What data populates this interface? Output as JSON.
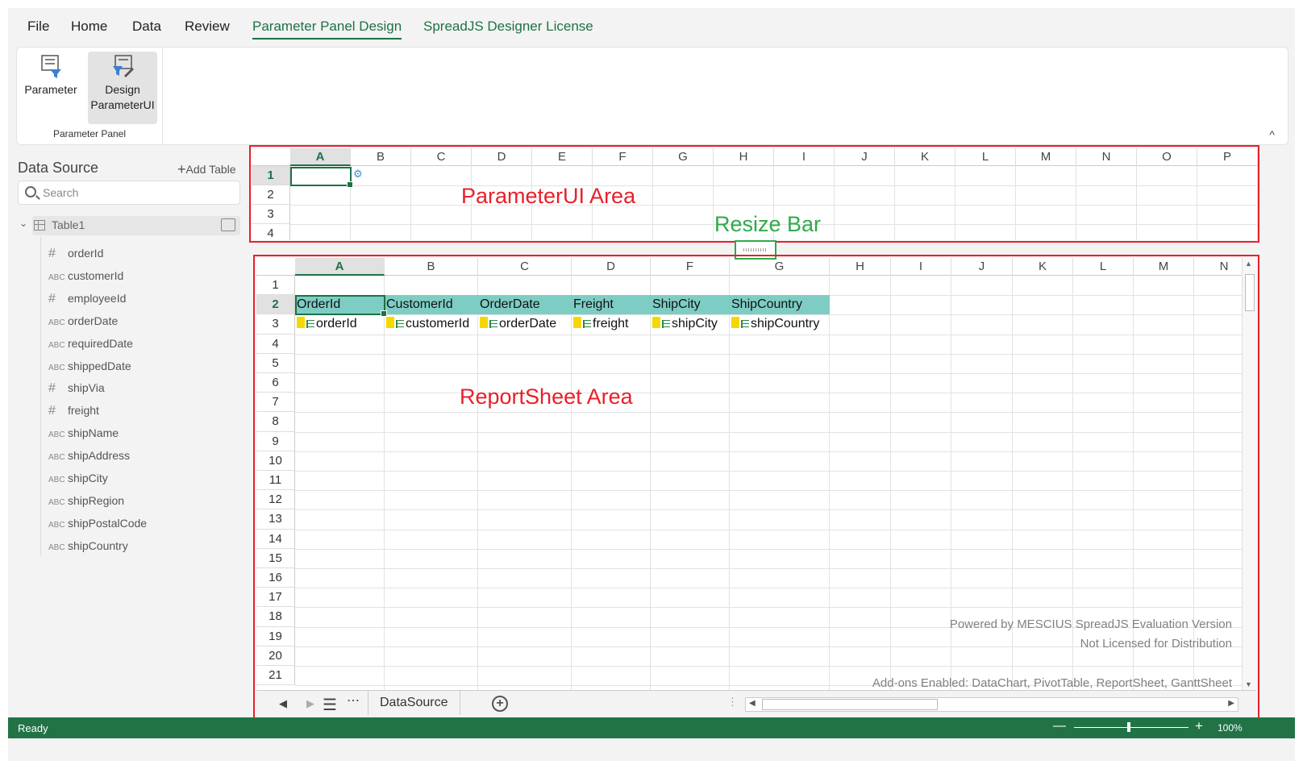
{
  "menu": {
    "items": [
      "File",
      "Home",
      "Data",
      "Review",
      "Parameter Panel Design",
      "SpreadJS Designer License"
    ],
    "active": "Parameter Panel Design"
  },
  "ribbon": {
    "parameter_label": "Parameter",
    "design_label_line1": "Design",
    "design_label_line2": "ParameterUI",
    "group_label": "Parameter Panel",
    "collapse_icon": "^"
  },
  "datasource": {
    "title": "Data Source",
    "add_table": "Add Table",
    "search_placeholder": "Search",
    "table_name": "Table1",
    "fields": [
      {
        "type": "#",
        "name": "orderId"
      },
      {
        "type": "ABC",
        "name": "customerId"
      },
      {
        "type": "#",
        "name": "employeeId"
      },
      {
        "type": "ABC",
        "name": "orderDate"
      },
      {
        "type": "ABC",
        "name": "requiredDate"
      },
      {
        "type": "ABC",
        "name": "shippedDate"
      },
      {
        "type": "#",
        "name": "shipVia"
      },
      {
        "type": "#",
        "name": "freight"
      },
      {
        "type": "ABC",
        "name": "shipName"
      },
      {
        "type": "ABC",
        "name": "shipAddress"
      },
      {
        "type": "ABC",
        "name": "shipCity"
      },
      {
        "type": "ABC",
        "name": "shipRegion"
      },
      {
        "type": "ABC",
        "name": "shipPostalCode"
      },
      {
        "type": "ABC",
        "name": "shipCountry"
      }
    ]
  },
  "param_sheet": {
    "columns": [
      "A",
      "B",
      "C",
      "D",
      "E",
      "F",
      "G",
      "H",
      "I",
      "J",
      "K",
      "L",
      "M",
      "N",
      "O",
      "P"
    ],
    "rows": [
      "1",
      "2",
      "3",
      "4"
    ],
    "active_cell": "A1"
  },
  "report_sheet": {
    "columns": [
      "A",
      "B",
      "C",
      "D",
      "F",
      "G",
      "H",
      "I",
      "J",
      "K",
      "L",
      "M",
      "N"
    ],
    "rows": [
      "1",
      "2",
      "3",
      "4",
      "5",
      "6",
      "7",
      "8",
      "9",
      "10",
      "11",
      "12",
      "13",
      "14",
      "15",
      "16",
      "17",
      "18",
      "19",
      "20",
      "21"
    ],
    "headers": [
      "OrderId",
      "CustomerId",
      "OrderDate",
      "Freight",
      "ShipCity",
      "ShipCountry"
    ],
    "bindings": [
      "orderId",
      "customerId",
      "orderDate",
      "freight",
      "shipCity",
      "shipCountry"
    ],
    "header_color": "#7ecdc4",
    "watermark": {
      "line1": "Powered by MESCIUS SpreadJS Evaluation Version",
      "line2": "Not Licensed for Distribution",
      "line3": "Add-ons Enabled: DataChart, PivotTable, ReportSheet, GanttSheet"
    },
    "tab_name": "DataSource"
  },
  "annotations": {
    "param_area": "ParameterUI Area",
    "resize_bar": "Resize Bar",
    "report_area": "ReportSheet Area",
    "box_color": "#e8202a",
    "resize_color": "#2eaa4a"
  },
  "status": {
    "text": "Ready",
    "zoom": "100%",
    "bar_color": "#217346"
  }
}
